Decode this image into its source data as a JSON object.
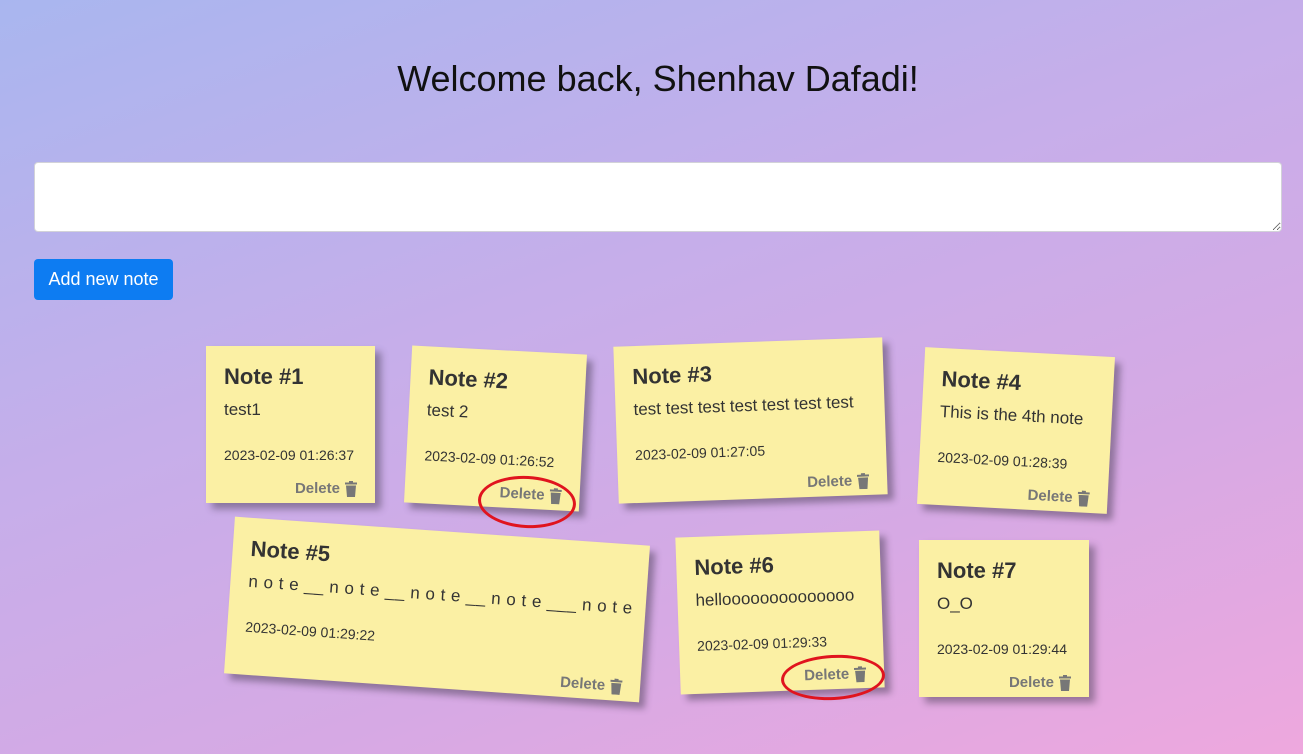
{
  "header": {
    "title": "Welcome back, Shenhav Dafadi!"
  },
  "composer": {
    "placeholder": "",
    "value": "",
    "add_label": "Add new note"
  },
  "notes": [
    {
      "title": "Note #1",
      "text": "test1",
      "date": "2023-02-09 01:26:37",
      "delete_label": "Delete"
    },
    {
      "title": "Note #2",
      "text": "test 2",
      "date": "2023-02-09 01:26:52",
      "delete_label": "Delete"
    },
    {
      "title": "Note #3",
      "text": "test test test test test test test",
      "date": "2023-02-09 01:27:05",
      "delete_label": "Delete"
    },
    {
      "title": "Note #4",
      "text": "This is the 4th note",
      "date": "2023-02-09 01:28:39",
      "delete_label": "Delete"
    },
    {
      "title": "Note #5",
      "text": "n o t e __ n o t e __ n o t e __ n o t e ___ n o t e",
      "date": "2023-02-09 01:29:22",
      "delete_label": "Delete"
    },
    {
      "title": "Note #6",
      "text": "helloooooooooooooo",
      "date": "2023-02-09 01:29:33",
      "delete_label": "Delete"
    },
    {
      "title": "Note #7",
      "text": "O_O",
      "date": "2023-02-09 01:29:44",
      "delete_label": "Delete"
    }
  ],
  "icons": {
    "delete": "trash-icon"
  },
  "colors": {
    "note_background": "#fbf0a4",
    "button_primary": "#0d7cf2",
    "highlight": "#e0141e"
  }
}
